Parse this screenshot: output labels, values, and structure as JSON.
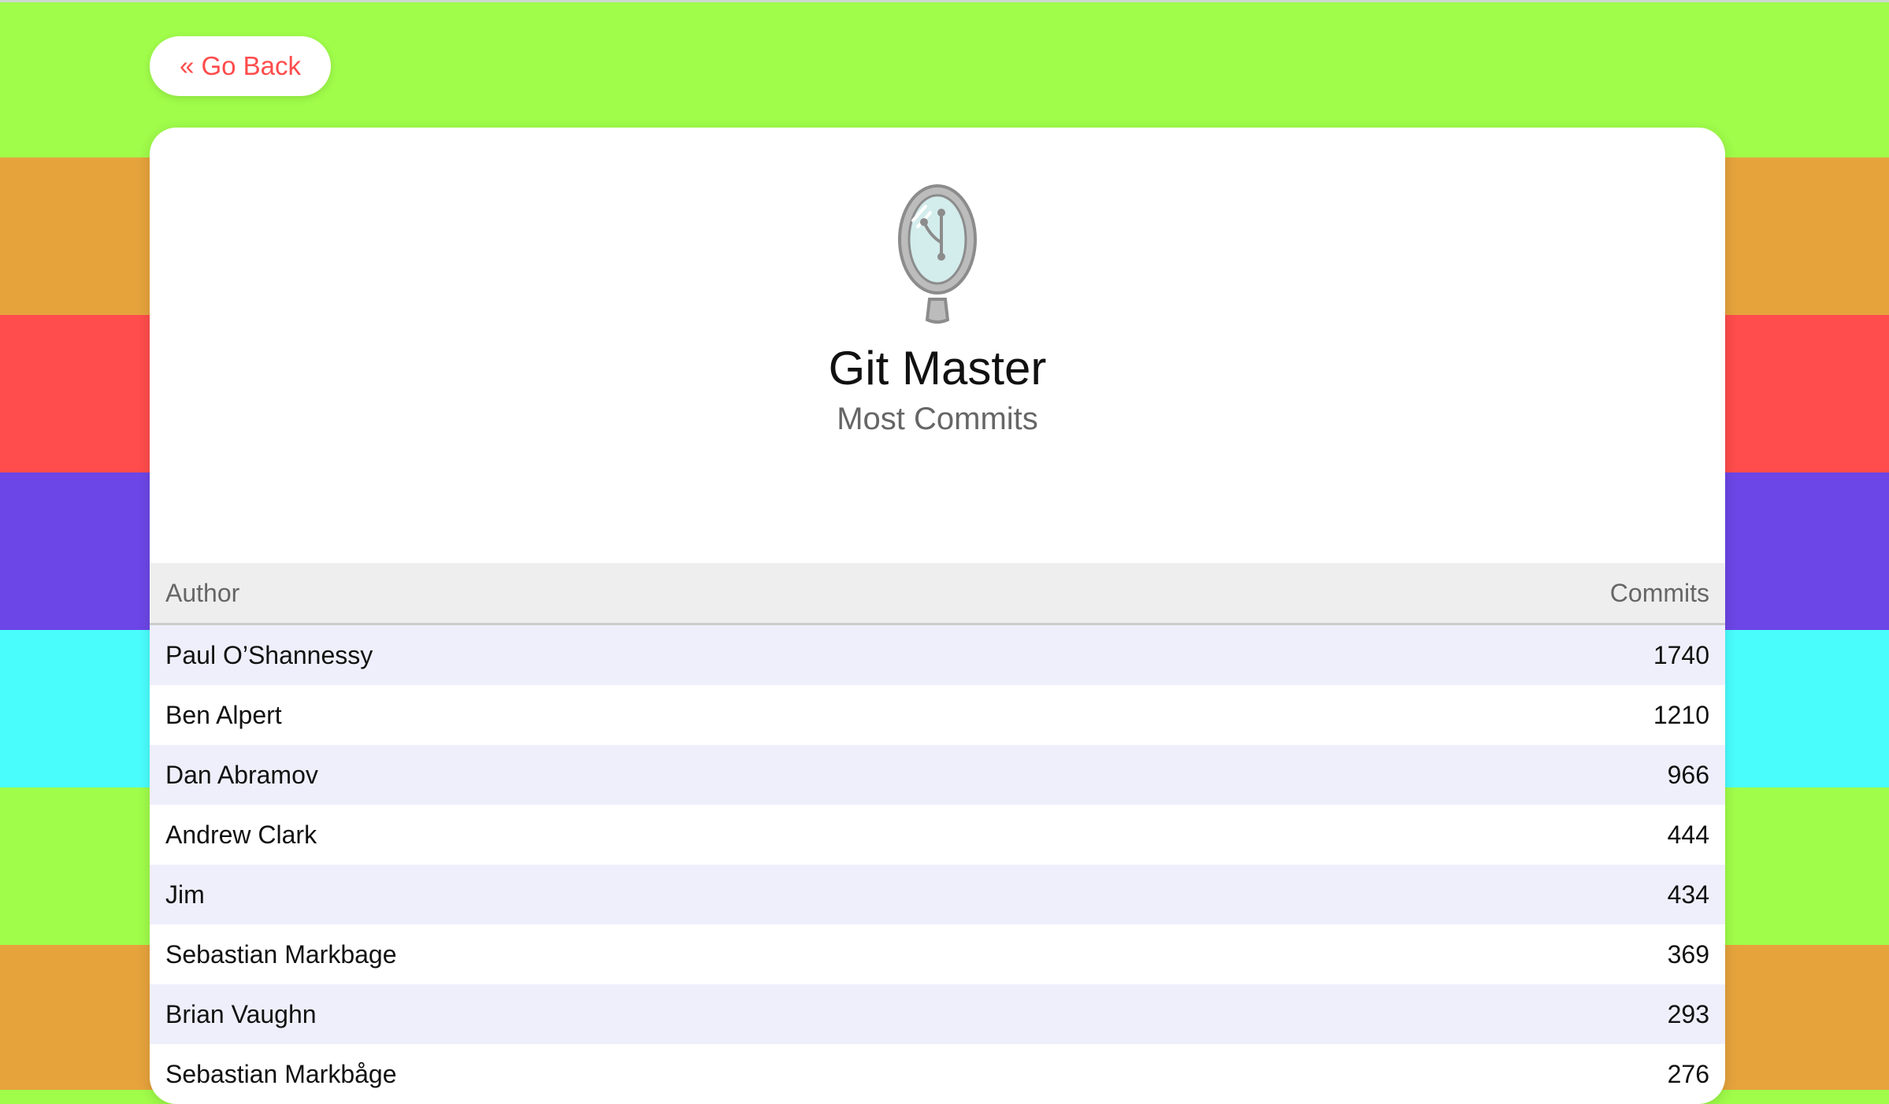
{
  "colors": {
    "stripes": [
      "#a0fd4a",
      "#e6a33c",
      "#ff4c4c",
      "#6c46e6",
      "#4afdfd",
      "#a0fd4a",
      "#e6a33c"
    ],
    "accent": "#ff4c4c",
    "row_alt": "#efeffc",
    "header_bg": "#eeeeee"
  },
  "nav": {
    "back_label": "« Go Back"
  },
  "award": {
    "icon": "mirror-git-branch-icon",
    "title": "Git Master",
    "subtitle": "Most Commits"
  },
  "table": {
    "headers": {
      "author": "Author",
      "commits": "Commits"
    },
    "rows": [
      {
        "author": "Paul O’Shannessy",
        "commits": "1740"
      },
      {
        "author": "Ben Alpert",
        "commits": "1210"
      },
      {
        "author": "Dan Abramov",
        "commits": "966"
      },
      {
        "author": "Andrew Clark",
        "commits": "444"
      },
      {
        "author": "Jim",
        "commits": "434"
      },
      {
        "author": "Sebastian Markbage",
        "commits": "369"
      },
      {
        "author": "Brian Vaughn",
        "commits": "293"
      },
      {
        "author": "Sebastian Markbåge",
        "commits": "276"
      }
    ]
  }
}
